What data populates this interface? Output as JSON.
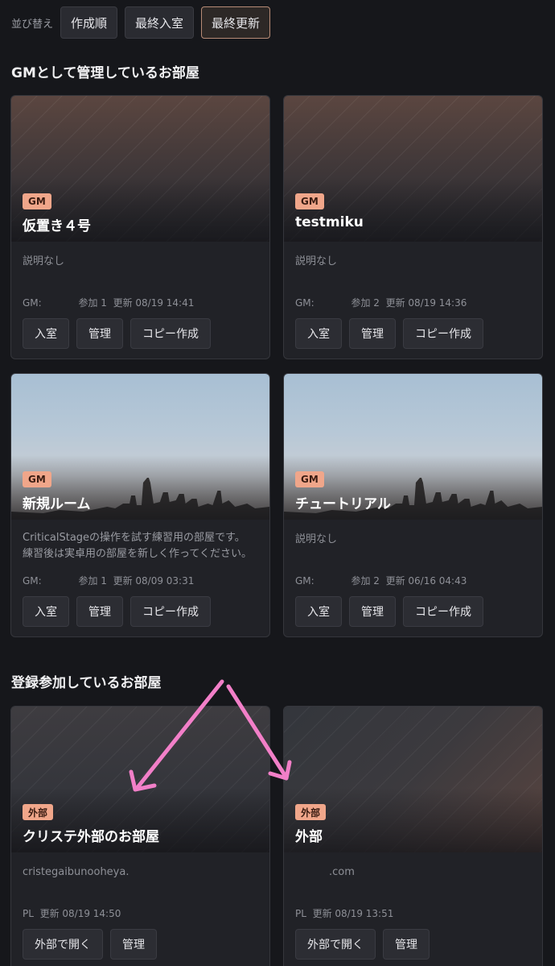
{
  "sort": {
    "label": "並び替え",
    "options": [
      {
        "label": "作成順",
        "active": false
      },
      {
        "label": "最終入室",
        "active": false
      },
      {
        "label": "最終更新",
        "active": true
      }
    ]
  },
  "sections": {
    "gm_title": "GMとして管理しているお部屋",
    "joined_title": "登録参加しているお部屋"
  },
  "gm_rooms": [
    {
      "badge": "GM",
      "title": "仮置き４号",
      "desc": "説明なし",
      "role": "GM:",
      "participants": "参加 1",
      "updated": "更新 08/19 14:41",
      "buttons": [
        "入室",
        "管理",
        "コピー作成"
      ]
    },
    {
      "badge": "GM",
      "title": "testmiku",
      "desc": "説明なし",
      "role": "GM:",
      "participants": "参加 2",
      "updated": "更新 08/19 14:36",
      "buttons": [
        "入室",
        "管理",
        "コピー作成"
      ]
    },
    {
      "badge": "GM",
      "title": "新規ルーム",
      "desc": "CriticalStageの操作を試す練習用の部屋です。\n練習後は実卓用の部屋を新しく作ってください。",
      "role": "GM:",
      "participants": "参加 1",
      "updated": "更新 08/09 03:31",
      "buttons": [
        "入室",
        "管理",
        "コピー作成"
      ]
    },
    {
      "badge": "GM",
      "title": "チュートリアル",
      "desc": "説明なし",
      "role": "GM:",
      "participants": "参加 2",
      "updated": "更新 06/16 04:43",
      "buttons": [
        "入室",
        "管理",
        "コピー作成"
      ]
    }
  ],
  "joined_rooms": [
    {
      "badge": "外部",
      "title": "クリステ外部のお部屋",
      "desc": "cristegaibunooheya.",
      "role": "PL",
      "updated": "更新 08/19 14:50",
      "buttons": [
        "外部で開く",
        "管理"
      ]
    },
    {
      "badge": "外部",
      "title": "外部",
      "desc": ".com",
      "role": "PL",
      "updated": "更新 08/19 13:51",
      "buttons": [
        "外部で開く",
        "管理"
      ]
    }
  ],
  "colors": {
    "accent": "#f0a68a",
    "arrow": "#f27fc8",
    "background": "#16171b"
  },
  "icons": [
    "down-left-arrow-annotation",
    "down-right-arrow-annotation"
  ]
}
